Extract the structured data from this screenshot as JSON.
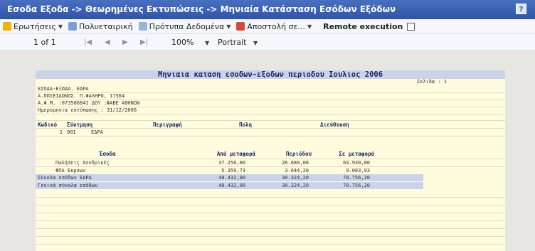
{
  "title": "Εσοδα Εξοδα -> Θεωρημένες Εκτυπώσεις -> Μηνιαία Κατάσταση Εσόδων Εξόδων",
  "help_label": "?",
  "toolbar": {
    "items": [
      {
        "label": "Ερωτήσεις",
        "icon": "question-icon"
      },
      {
        "label": "Πολυεταιρική",
        "icon": "multi-company-icon"
      },
      {
        "label": "Πρότυπα Δεδομένα",
        "icon": "template-data-icon"
      },
      {
        "label": "Αποστολή σε...",
        "icon": "send-icon"
      }
    ],
    "remote_label": "Remote execution"
  },
  "pager": {
    "page": "1 of 1",
    "zoom": "100%",
    "orientation": "Portrait"
  },
  "report": {
    "title": "Μηνιαια καταση εσοδων-εξοδων περιοδου Ιουλιος 2006",
    "page_label": "Σελιδα : 1",
    "company": "ΕΣΟΔΑ-ΕΞΟΔΑ. ΕΔΡΑ",
    "address": "Α.ΠΟΣΕΙΔΩΝΟΣ. Π.ΦΑΛΗΡΟ, 17564",
    "tax": "Α.Φ.Μ. :073586841 ΔΟΥ :ΦΑΒΕ ΑΘΗΝΩΝ",
    "print_date": "Ημερομηνια εκτύπωσης : 31/12/2006",
    "branch_headers": {
      "code": "Κωδικό",
      "short": "Σύντμηση",
      "desc": "Περιγραφή",
      "city": "Πολη",
      "address": "Διεύθυνση"
    },
    "branch_row": {
      "num": "1",
      "code": "001",
      "short": "ΕΔΡΑ"
    },
    "columns": {
      "label": "Έσοδα",
      "from": "Από μεταφορά",
      "period": "Περιόδου",
      "to": "Σε μεταφορά"
    },
    "rows": [
      {
        "label": "Πωλήσεις Χονδρικές",
        "from": "37.250,00",
        "period": "26.680,00",
        "to": "63.930,00"
      },
      {
        "label": "ΦΠΑ Εκροων",
        "from": "5.359,73",
        "period": "3.644,20",
        "to": "9.003,93"
      }
    ],
    "totals": [
      {
        "label": "Σύνολα εσόδων ΕΔΡΑ",
        "from": "48.432,00",
        "period": "30.324,20",
        "to": "78.756,20"
      },
      {
        "label": "Γενικά σύνολα εσόδων",
        "from": "48.432,00",
        "period": "30.324,20",
        "to": "78.756,20"
      }
    ]
  }
}
